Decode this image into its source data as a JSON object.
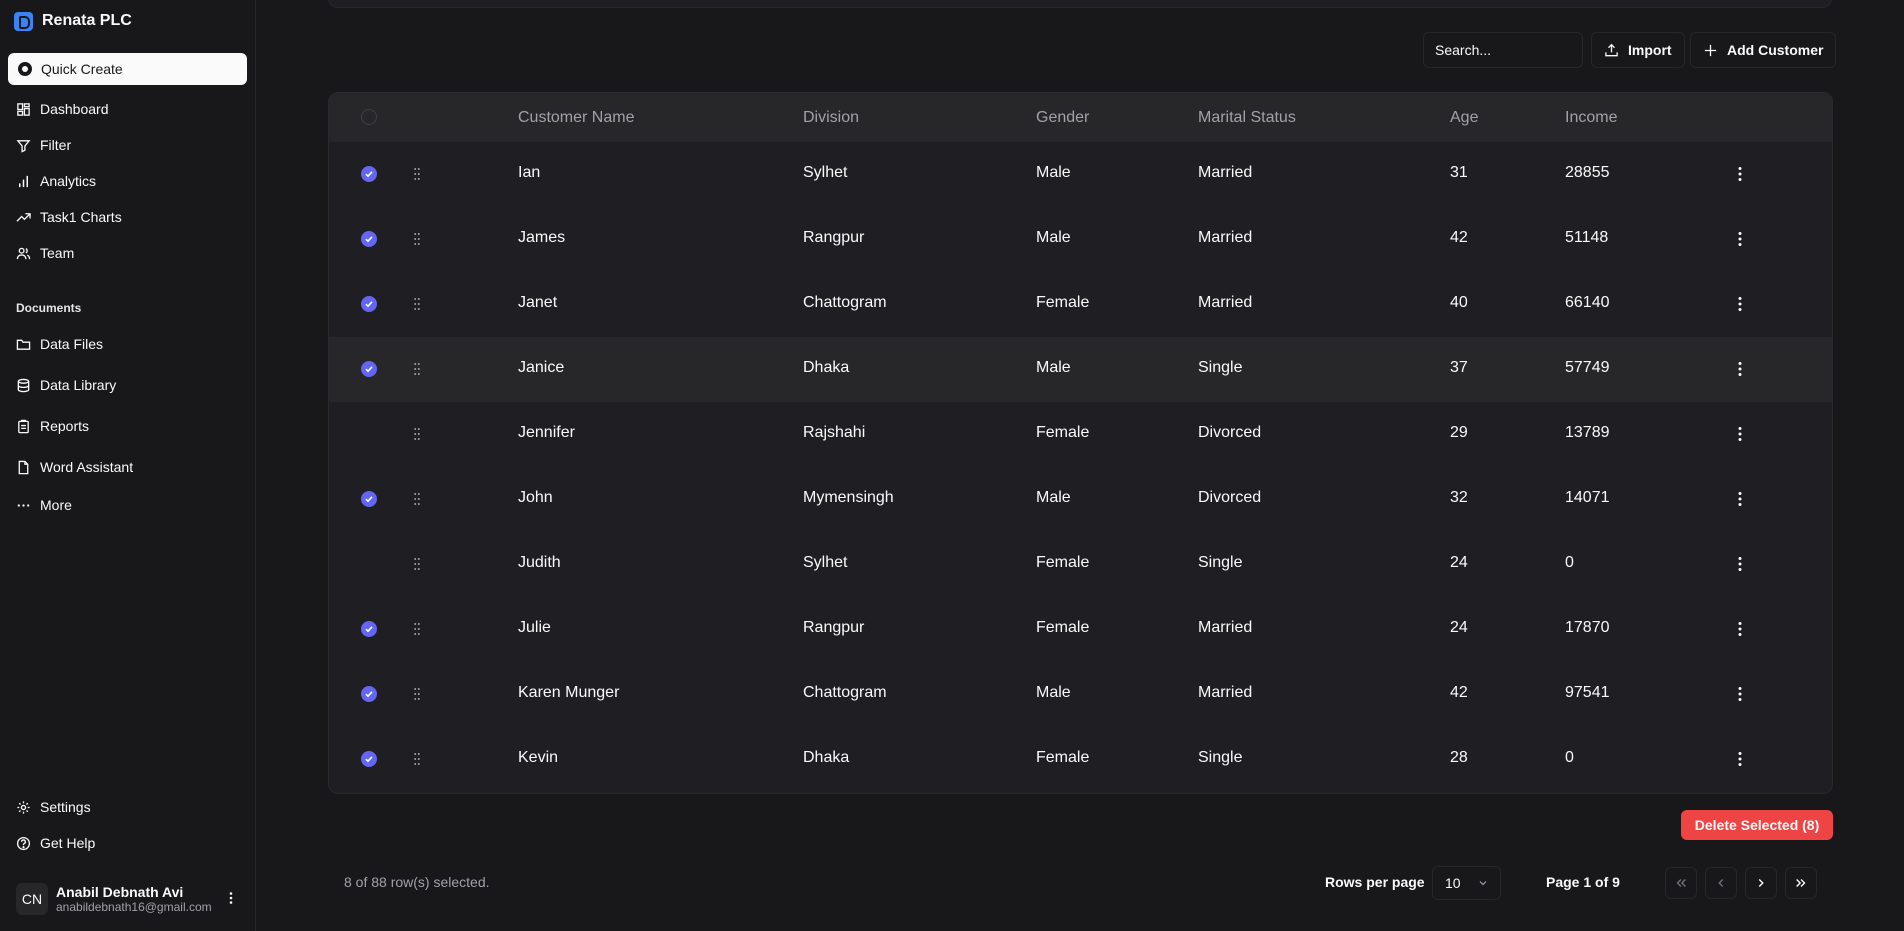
{
  "sidebar": {
    "brand": "Renata PLC",
    "quick_create": "Quick Create",
    "nav": [
      {
        "label": "Dashboard",
        "icon": "dashboard-icon"
      },
      {
        "label": "Filter",
        "icon": "filter-icon"
      },
      {
        "label": "Analytics",
        "icon": "bar-chart-icon"
      },
      {
        "label": "Task1 Charts",
        "icon": "trend-icon"
      },
      {
        "label": "Team",
        "icon": "users-icon"
      }
    ],
    "documents_label": "Documents",
    "documents": [
      {
        "label": "Data Files",
        "icon": "folder-icon"
      },
      {
        "label": "Data Library",
        "icon": "database-icon"
      },
      {
        "label": "Reports",
        "icon": "clipboard-icon"
      },
      {
        "label": "Word Assistant",
        "icon": "file-icon"
      },
      {
        "label": "More",
        "icon": "more-icon"
      }
    ],
    "footer": [
      {
        "label": "Settings",
        "icon": "gear-icon"
      },
      {
        "label": "Get Help",
        "icon": "help-icon"
      }
    ],
    "user": {
      "initials": "CN",
      "name": "Anabil Debnath Avi",
      "email": "anabildebnath16@gmail.com"
    }
  },
  "toolbar": {
    "search_placeholder": "Search...",
    "import_label": "Import",
    "add_label": "Add Customer"
  },
  "table": {
    "columns": [
      "Customer Name",
      "Division",
      "Gender",
      "Marital Status",
      "Age",
      "Income"
    ],
    "rows": [
      {
        "selected": true,
        "name": "Ian",
        "division": "Sylhet",
        "gender": "Male",
        "marital": "Married",
        "age": "31",
        "income": "28855"
      },
      {
        "selected": true,
        "name": "James",
        "division": "Rangpur",
        "gender": "Male",
        "marital": "Married",
        "age": "42",
        "income": "51148"
      },
      {
        "selected": true,
        "name": "Janet",
        "division": "Chattogram",
        "gender": "Female",
        "marital": "Married",
        "age": "40",
        "income": "66140"
      },
      {
        "selected": true,
        "name": "Janice",
        "division": "Dhaka",
        "gender": "Male",
        "marital": "Single",
        "age": "37",
        "income": "57749"
      },
      {
        "selected": false,
        "name": "Jennifer",
        "division": "Rajshahi",
        "gender": "Female",
        "marital": "Divorced",
        "age": "29",
        "income": "13789"
      },
      {
        "selected": true,
        "name": "John",
        "division": "Mymensingh",
        "gender": "Male",
        "marital": "Divorced",
        "age": "32",
        "income": "14071"
      },
      {
        "selected": false,
        "name": "Judith",
        "division": "Sylhet",
        "gender": "Female",
        "marital": "Single",
        "age": "24",
        "income": "0"
      },
      {
        "selected": true,
        "name": "Julie",
        "division": "Rangpur",
        "gender": "Female",
        "marital": "Married",
        "age": "24",
        "income": "17870"
      },
      {
        "selected": true,
        "name": "Karen Munger",
        "division": "Chattogram",
        "gender": "Male",
        "marital": "Married",
        "age": "42",
        "income": "97541"
      },
      {
        "selected": true,
        "name": "Kevin",
        "division": "Dhaka",
        "gender": "Female",
        "marital": "Single",
        "age": "28",
        "income": "0"
      }
    ]
  },
  "delete_label": "Delete Selected (8)",
  "footer": {
    "selection": "8 of 88 row(s) selected.",
    "rows_per_page_label": "Rows per page",
    "rows_per_page": "10",
    "page_label": "Page 1 of 9"
  },
  "colors": {
    "accent": "#6366f1",
    "danger": "#ef4444",
    "background": "#18181b"
  }
}
